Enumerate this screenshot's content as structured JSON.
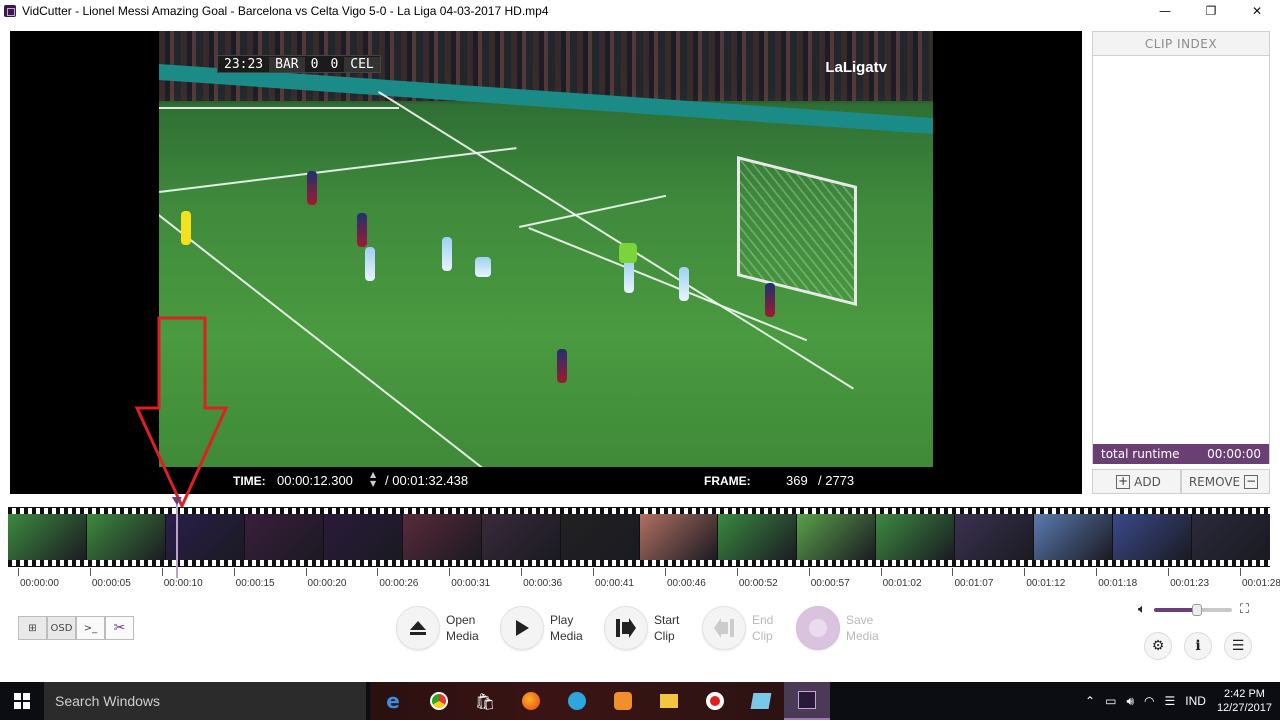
{
  "window": {
    "title": "VidCutter - Lionel Messi Amazing Goal - Barcelona vs Celta Vigo 5-0 - La Liga 04-03-2017 HD.mp4",
    "controls": [
      "minimize-icon",
      "restore-icon",
      "close-icon"
    ]
  },
  "video": {
    "scoreboard": {
      "clock": "23:23",
      "home": "BAR",
      "home_score": "0",
      "away_score": "0",
      "away": "CEL"
    },
    "broadcast_logo": "LaLigatv",
    "time_label": "TIME:",
    "time_current": "00:00:12.300",
    "time_total": "/ 00:01:32.438",
    "frame_label": "FRAME:",
    "frame_current": "369",
    "frame_total": "/ 2773"
  },
  "clip_index": {
    "header": "CLIP INDEX",
    "total_runtime_label": "total runtime",
    "total_runtime_value": "00:00:00",
    "add_label": "ADD",
    "remove_label": "REMOVE"
  },
  "timeline": {
    "playhead_fraction": 0.133,
    "ticks": [
      "00:00:00",
      "00:00:05",
      "00:00:10",
      "00:00:15",
      "00:00:20",
      "00:00:26",
      "00:00:31",
      "00:00:36",
      "00:00:41",
      "00:00:46",
      "00:00:52",
      "00:00:57",
      "00:01:02",
      "00:01:07",
      "00:01:12",
      "00:01:18",
      "00:01:23",
      "00:01:28"
    ],
    "frame_colors": [
      "#3d8a3e",
      "#3d8a3e",
      "#2a1e4a",
      "#3a1e3c",
      "#2a1a3a",
      "#5a2a3a",
      "#3a2a3a",
      "#222222",
      "#b07060",
      "#3a8a40",
      "#5aa04a",
      "#3d8a40",
      "#3a3250",
      "#5a7ab0",
      "#3a4a8a",
      "#2a2a3a"
    ]
  },
  "toggles": {
    "fullscreen_edit": "⊞",
    "osd": "OSD",
    "console": ">_",
    "cut": "✂"
  },
  "controls": {
    "open": "Open\nMedia",
    "play": "Play\nMedia",
    "start_clip": "Start\nClip",
    "end_clip": "End\nClip",
    "save": "Save\nMedia"
  },
  "volume": {
    "level": 0.55
  },
  "taskbar": {
    "search_placeholder": "Search Windows",
    "language": "IND",
    "time": "2:42 PM",
    "date": "12/27/2017"
  },
  "colors": {
    "accent": "#6a3f74",
    "annotation": "#e02020"
  }
}
